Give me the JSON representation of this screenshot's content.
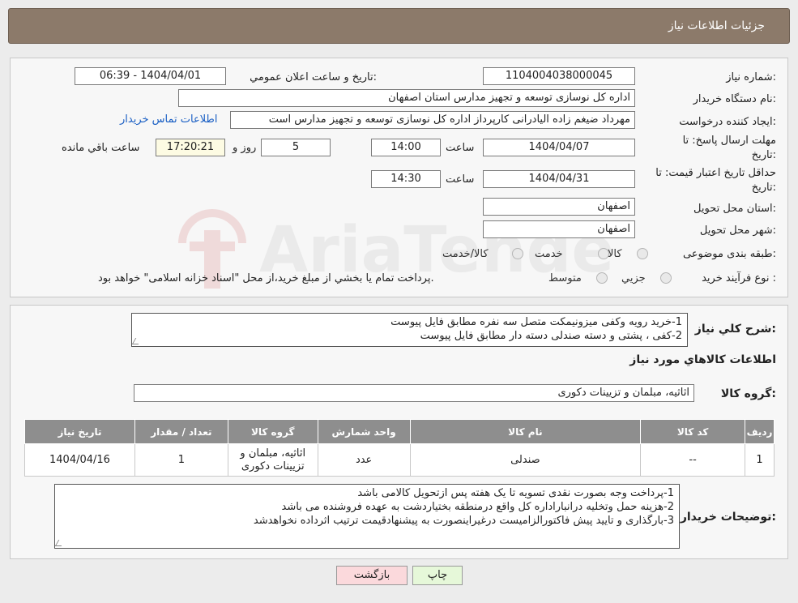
{
  "window": {
    "title": "جزئيات اطلاعات نياز"
  },
  "form": {
    "need_number_label": "شماره نياز:",
    "need_number": "1104004038000045",
    "announce_label": "تاريخ و ساعت اعلان عمومي:",
    "announce_value": "1404/04/01 - 06:39",
    "buyer_org_label": "نام دستگاه خريدار:",
    "buyer_org": "اداره کل نوسازی  توسعه و تجهیز مدارس استان اصفهان",
    "creator_label": "ايجاد کننده درخواست:",
    "creator": "مهرداد ضیغم زاده الیادرانی کارپرداز اداره کل نوسازی  توسعه و تجهیز مدارس است",
    "contact_link": "اطلاعات تماس خريدار",
    "deadline_label_1": "مهلت ارسال پاسخ: تا",
    "deadline_label_2": "تاريخ:",
    "deadline_date": "1404/04/07",
    "time_label": "ساعت",
    "deadline_time": "14:00",
    "days_value": "5",
    "days_label": "روز و",
    "remaining_time": "17:20:21",
    "remaining_label": "ساعت باقي مانده",
    "validity_label_1": "حداقل تاريخ اعتبار قيمت: تا",
    "validity_label_2": "تاريخ:",
    "validity_date": "1404/04/31",
    "validity_time": "14:30",
    "province_label": "استان محل تحويل:",
    "province": "اصفهان",
    "city_label": "شهر محل تحويل:",
    "city": "اصفهان",
    "category_label": "طبقه بندی موضوعی:",
    "category_options": [
      "کالا",
      "خدمت",
      "کالا/خدمت"
    ],
    "process_label": "نوع فرآيند خريد :",
    "process_options": [
      "جزيي",
      "متوسط"
    ],
    "process_note": "پرداخت تمام يا بخشي از مبلغ خريد،از محل \"اسناد خزانه اسلامی\" خواهد بود."
  },
  "summary": {
    "label": "شرح کلي نياز:",
    "lines": [
      "1-خرید رویه وکفی میزونیمکت متصل سه نفره مطابق فایل پیوست",
      "2-کفی ، پشتی و دسته صندلی دسته دار مطابق فایل پیوست"
    ]
  },
  "goods": {
    "section_title": "اطلاعات کالاهاي مورد نياز",
    "group_label": "گروه کالا:",
    "group_value": "اثاثیه، مبلمان و تزیینات دکوری",
    "columns": [
      "رديف",
      "کد کالا",
      "نام کالا",
      "واحد شمارش",
      "گروه کالا",
      "تعداد / مقدار",
      "تاريخ نياز"
    ],
    "rows": [
      {
        "row": "1",
        "code": "--",
        "name": "صندلی",
        "unit": "عدد",
        "group_line1": "اثاثیه، مبلمان و",
        "group_line2": "تزیینات دکوری",
        "qty": "1",
        "date": "1404/04/16"
      }
    ]
  },
  "buyer_notes": {
    "label": "توضيحات خريدار:",
    "lines": [
      "1-پرداخت وجه بصورت نقدی تسویه تا یک هفته پس ازتحویل کالامی باشد",
      "2-هزینه حمل وتخلیه درانباراداره کل واقع درمنطقه بختیاردشت به عهده فروشنده می باشد",
      "3-بارگذاری و تایید پیش فاکتورالزامیست درغیراینصورت به پیشنهادقیمت ترتیب اثرداده نخواهدشد"
    ]
  },
  "buttons": {
    "print": "چاپ",
    "back": "بازگشت"
  },
  "watermark": {
    "text": "AriaTender.neT"
  },
  "colors": {
    "titlebar": "#8c7a6a",
    "link": "#1a5fc4",
    "back_button": "#fbd9dc",
    "print_button": "#e6f8d9",
    "table_header": "#8e8e8e"
  }
}
